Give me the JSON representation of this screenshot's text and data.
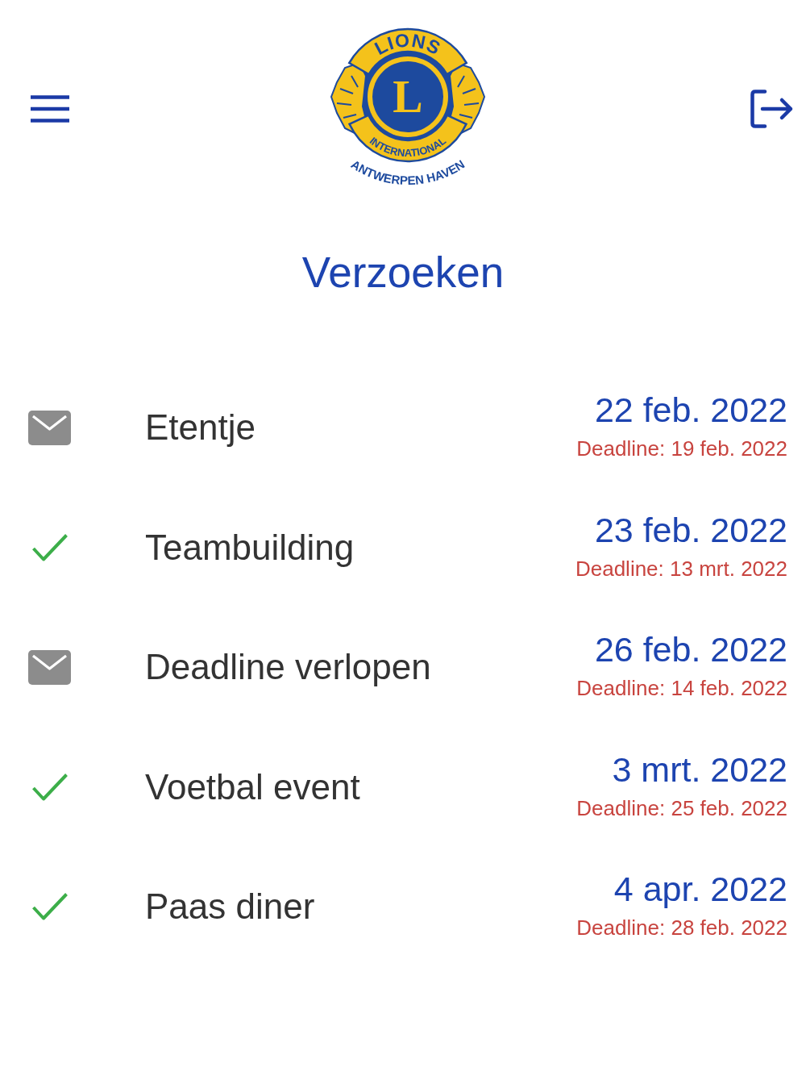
{
  "header": {
    "logo": {
      "top_text": "LIONS",
      "letter": "L",
      "band_text": "INTERNATIONAL",
      "club_text": "ANTWERPEN HAVEN"
    }
  },
  "title": "Verzoeken",
  "requests": [
    {
      "accepted": false,
      "name": "Etentje",
      "date": "22 feb. 2022",
      "deadline": "Deadline: 19 feb. 2022"
    },
    {
      "accepted": true,
      "name": "Teambuilding",
      "date": "23 feb. 2022",
      "deadline": "Deadline: 13 mrt. 2022"
    },
    {
      "accepted": false,
      "name": "Deadline verlopen",
      "date": "26 feb. 2022",
      "deadline": "Deadline: 14 feb. 2022"
    },
    {
      "accepted": true,
      "name": "Voetbal event",
      "date": "3 mrt. 2022",
      "deadline": "Deadline: 25 feb. 2022"
    },
    {
      "accepted": true,
      "name": "Paas diner",
      "date": "4 apr. 2022",
      "deadline": "Deadline: 28 feb. 2022"
    }
  ]
}
